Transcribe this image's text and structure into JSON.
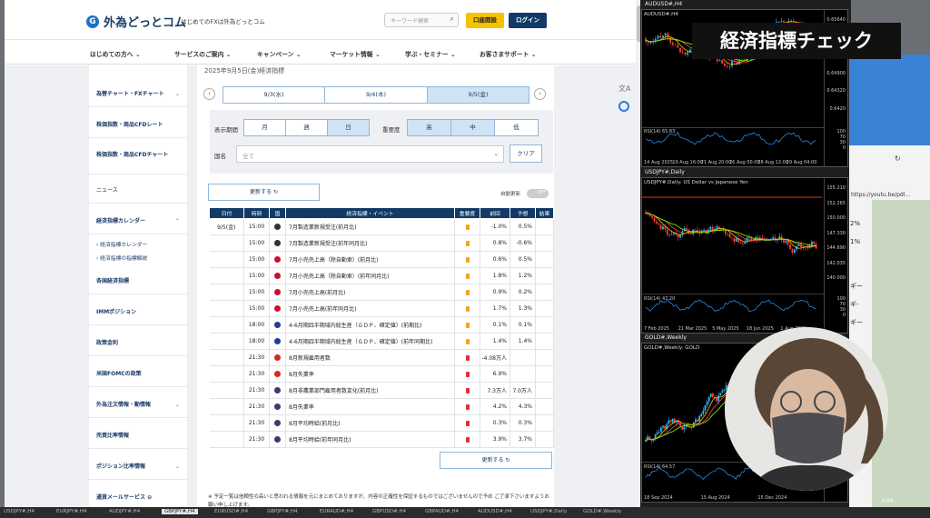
{
  "site": {
    "logo": "外為どっとコム",
    "tagline": "はじめてのFXは外為どっとコム",
    "search_placeholder": "キーワード検索",
    "btn_open_account": "口座開設",
    "btn_login": "ログイン",
    "nav": [
      "はじめての方へ",
      "サービスのご案内",
      "キャンペーン",
      "マーケット情報",
      "学ぶ・セミナー",
      "お客さまサポート"
    ]
  },
  "sidebar": {
    "items": [
      "為替チャート・FXチャート",
      "株価指数・商品CFDレート",
      "株価指数・商品CFDチャート",
      "ニュース",
      "経済指標カレンダー",
      "各国経済指標",
      "IMMポジション",
      "政策金利",
      "米国FOMCの政策",
      "外為注文情報・動情報",
      "売買比率情報",
      "ポジション比率情報",
      "通貨メールサービス"
    ],
    "sub": [
      "経済指標カレンダー",
      "経済指標の指標解説"
    ]
  },
  "calendar": {
    "date_title": "2025年9月5日(金)経済指標",
    "days": [
      "9/3(水)",
      "9/4(木)",
      "9/5(金)"
    ],
    "period_label": "表示期間",
    "periods": [
      "月",
      "週",
      "日"
    ],
    "importance_label": "重要度",
    "importance": [
      "高",
      "中",
      "低"
    ],
    "country_label": "国名",
    "country_value": "全て",
    "clear": "クリア",
    "update": "更新する ↻",
    "auto_update": "自動更新",
    "toggle": "OFF",
    "headers": [
      "日付",
      "時刻",
      "国",
      "経済指標・イベント",
      "重要度",
      "前回",
      "予想",
      "結果"
    ],
    "date_cell": "9/5(金)",
    "rows": [
      {
        "time": "15:00",
        "flag": "de",
        "event": "7月製造業新規受注(前月比)",
        "imp": "mid",
        "prev": "-1.0%",
        "fc": "0.5%"
      },
      {
        "time": "15:00",
        "flag": "de",
        "event": "7月製造業新規受注(前年同月比)",
        "imp": "mid",
        "prev": "0.8%",
        "fc": "-0.6%"
      },
      {
        "time": "15:00",
        "flag": "gb",
        "event": "7月小売売上高（除自動車）(前月比)",
        "imp": "mid",
        "prev": "0.6%",
        "fc": "0.5%"
      },
      {
        "time": "15:00",
        "flag": "gb",
        "event": "7月小売売上高（除自動車）(前年同月比)",
        "imp": "mid",
        "prev": "1.8%",
        "fc": "1.2%"
      },
      {
        "time": "15:00",
        "flag": "gb",
        "event": "7月小売売上高(前月比)",
        "imp": "mid",
        "prev": "0.9%",
        "fc": "0.2%"
      },
      {
        "time": "15:00",
        "flag": "gb",
        "event": "7月小売売上高(前年同月比)",
        "imp": "mid",
        "prev": "1.7%",
        "fc": "1.3%"
      },
      {
        "time": "18:00",
        "flag": "eu",
        "event": "4-6月期四半期域内総生産（ＧＤＰ、確定値）(前期比)",
        "imp": "mid",
        "prev": "0.1%",
        "fc": "0.1%"
      },
      {
        "time": "18:00",
        "flag": "eu",
        "event": "4-6月期四半期域内総生産（ＧＤＰ、確定値）(前年同期比)",
        "imp": "mid",
        "prev": "1.4%",
        "fc": "1.4%"
      },
      {
        "time": "21:30",
        "flag": "ca",
        "event": "8月新規雇用者数",
        "imp": "high",
        "prev": "-4.08万人",
        "fc": ""
      },
      {
        "time": "21:30",
        "flag": "ca",
        "event": "8月失業率",
        "imp": "high",
        "prev": "6.9%",
        "fc": ""
      },
      {
        "time": "21:30",
        "flag": "us",
        "event": "8月非農業部門雇用者数変化(前月比)",
        "imp": "high",
        "prev": "7.3万人",
        "fc": "7.0万人"
      },
      {
        "time": "21:30",
        "flag": "us",
        "event": "8月失業率",
        "imp": "high",
        "prev": "4.2%",
        "fc": "4.3%"
      },
      {
        "time": "21:30",
        "flag": "us",
        "event": "8月平均時給(前月比)",
        "imp": "high",
        "prev": "0.3%",
        "fc": "0.3%"
      },
      {
        "time": "21:30",
        "flag": "us",
        "event": "8月平均時給(前年同月比)",
        "imp": "high",
        "prev": "3.9%",
        "fc": "3.7%"
      }
    ],
    "note": "※ 予定一覧は信頼性の高いと思われる情報を元にまとめておりますが、内容の正確性を保証するものではございませんので予め ご了承下さいますようお願い申し上げます。"
  },
  "charts": [
    {
      "title": "AUDUSD#,H4",
      "inner": "AUDUSD#,H4",
      "prices": [
        "0.65640",
        "0.65435",
        "0.6500",
        "0.64900",
        "0.64320",
        "0.6420"
      ],
      "rsi": "RSI(14) 65.83",
      "rsi_levels": [
        "100",
        "70",
        "30",
        "0"
      ],
      "x": [
        "14 Aug 2025",
        "19 Aug 16:00",
        "21 Aug 20:00",
        "26 Aug 00:00",
        "28 Aug 12:00",
        "29 Aug 04:00"
      ]
    },
    {
      "title": "USDJPY#,Daily",
      "inner": "USDJPY#,Daily: US Dollar vs Japanese Yen",
      "prices": [
        "155.210",
        "152.265",
        "150.000",
        "147.330",
        "144.690",
        "142.035",
        "140.000"
      ],
      "rsi": "RSI(14) 47.20",
      "rsi_levels": [
        "100",
        "70",
        "30",
        "0"
      ],
      "x": [
        "7 Feb 2025",
        "21 Mar 2025",
        "5 May 2025",
        "18 Jun 2025",
        "1 Aug 2025"
      ]
    },
    {
      "title": "GOLD#,Weekly",
      "inner": "GOLD#,Weekly: GOLD",
      "prices": [],
      "rsi": "RSI(14) 64.57",
      "rsi_levels": [],
      "x": [
        "18 Sep 2024",
        "15 Aug 2024",
        "15 Dec 2024"
      ]
    }
  ],
  "overlay_title": "経済指標チェック",
  "right_window": {
    "url": "https://youtu.be/pdl...",
    "partial": [
      "2%",
      "1%",
      "ギー",
      "ギ-",
      "ギー"
    ],
    "time": "3:04"
  },
  "taskbar": [
    "USDJPY#,H4",
    "EURJPY#,H4",
    "AUDJPY#,H4",
    "GBPJPY#,H4",
    "EURUSD#,H4",
    "GBPJPY#,H4",
    "EURAUD#,H4",
    "GBPUSD#,H4",
    "GBPAUD#,H4",
    "AUDUSD#,H4",
    "USDJPY#,Daily",
    "GOLD#,Weekly"
  ]
}
